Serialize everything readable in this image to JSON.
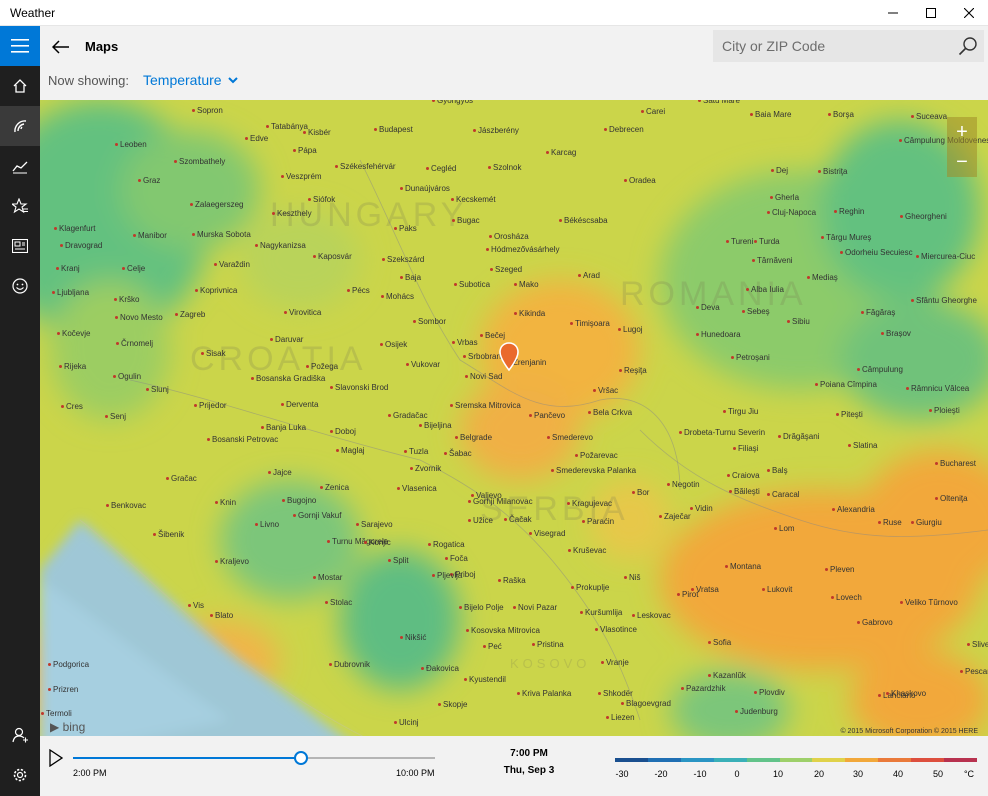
{
  "window": {
    "title": "Weather"
  },
  "header": {
    "page_title": "Maps",
    "now_showing_label": "Now showing:",
    "now_showing_value": "Temperature",
    "search_placeholder": "City or ZIP Code"
  },
  "sidebar": {
    "items": [
      "home-icon",
      "maps-icon",
      "historical-weather-icon",
      "favorites-icon",
      "news-icon",
      "feedback-icon",
      "account-icon",
      "settings-icon"
    ],
    "active_index": 1,
    "accent": "#0078d7"
  },
  "map": {
    "country_labels": [
      "HUNGARY",
      "ROMANIA",
      "CROATIA",
      "SERBIA",
      "KOSOVO"
    ],
    "cities": [
      {
        "name": "Gyongyos"
      },
      {
        "name": "Satu Mare"
      },
      {
        "name": "Sopron"
      },
      {
        "name": "Tatabánya"
      },
      {
        "name": "Budapest"
      },
      {
        "name": "Jászberény"
      },
      {
        "name": "Debrecen"
      },
      {
        "name": "Carei"
      },
      {
        "name": "Baia Mare"
      },
      {
        "name": "Borşa"
      },
      {
        "name": "Suceava"
      },
      {
        "name": "Kisbér"
      },
      {
        "name": "Edve"
      },
      {
        "name": "Leoben"
      },
      {
        "name": "Pápa"
      },
      {
        "name": "Szombathely"
      },
      {
        "name": "Székesfehérvár"
      },
      {
        "name": "Cegléd"
      },
      {
        "name": "Szolnok"
      },
      {
        "name": "Karcag"
      },
      {
        "name": "Câmpulung Moldovenesc"
      },
      {
        "name": "Graz"
      },
      {
        "name": "Veszprém"
      },
      {
        "name": "Dunaújváros"
      },
      {
        "name": "Kecskemét"
      },
      {
        "name": "Oradea"
      },
      {
        "name": "Dej"
      },
      {
        "name": "Bistriţa"
      },
      {
        "name": "Siófok"
      },
      {
        "name": "Gherla"
      },
      {
        "name": "Zalaegerszeg"
      },
      {
        "name": "Keszthely"
      },
      {
        "name": "Bugac"
      },
      {
        "name": "Békéscsaba"
      },
      {
        "name": "Cluj-Napoca"
      },
      {
        "name": "Reghin"
      },
      {
        "name": "Gheorgheni"
      },
      {
        "name": "Klagenfurt"
      },
      {
        "name": "Paks"
      },
      {
        "name": "Orosháza"
      },
      {
        "name": "Turda"
      },
      {
        "name": "Manibor"
      },
      {
        "name": "Murska Sobota"
      },
      {
        "name": "Hódmezővásárhely"
      },
      {
        "name": "Tureni"
      },
      {
        "name": "Târgu Mureş"
      },
      {
        "name": "Dravograd"
      },
      {
        "name": "Nagykanizsa"
      },
      {
        "name": "Kaposvár"
      },
      {
        "name": "Szekszárd"
      },
      {
        "name": "Odorheiu Secuiesc"
      },
      {
        "name": "Miercurea-Ciuc"
      },
      {
        "name": "Varaždin"
      },
      {
        "name": "Szeged"
      },
      {
        "name": "Târnăveni"
      },
      {
        "name": "Kranj"
      },
      {
        "name": "Celje"
      },
      {
        "name": "Koprivnica"
      },
      {
        "name": "Pécs"
      },
      {
        "name": "Baja"
      },
      {
        "name": "Subotica"
      },
      {
        "name": "Arad"
      },
      {
        "name": "Mediaş"
      },
      {
        "name": "Ljubljana"
      },
      {
        "name": "Mohács"
      },
      {
        "name": "Mako"
      },
      {
        "name": "Alba Iulia"
      },
      {
        "name": "Sfântu Gheorghe"
      },
      {
        "name": "Krško"
      },
      {
        "name": "Virovitica"
      },
      {
        "name": "Kikinda"
      },
      {
        "name": "Timişoara"
      },
      {
        "name": "Deva"
      },
      {
        "name": "Sebeş"
      },
      {
        "name": "Făgăraş"
      },
      {
        "name": "Kočevje"
      },
      {
        "name": "Novo Mesto"
      },
      {
        "name": "Zagreb"
      },
      {
        "name": "Sombor"
      },
      {
        "name": "Lugoj"
      },
      {
        "name": "Sibiu"
      },
      {
        "name": "Brașov"
      },
      {
        "name": "Bečej"
      },
      {
        "name": "Daruvar"
      },
      {
        "name": "Hunedoara"
      },
      {
        "name": "Črnomelj"
      },
      {
        "name": "Osijek"
      },
      {
        "name": "Vrbas"
      },
      {
        "name": "Srbobran"
      },
      {
        "name": "Zrenjanin"
      },
      {
        "name": "Sisak"
      },
      {
        "name": "Petroşani"
      },
      {
        "name": "Rijeka"
      },
      {
        "name": "Vukovar"
      },
      {
        "name": "Novi Sad"
      },
      {
        "name": "Reşiţa"
      },
      {
        "name": "Câmpulung"
      },
      {
        "name": "Ogulin"
      },
      {
        "name": "Bosanska Gradiška"
      },
      {
        "name": "Požega"
      },
      {
        "name": "Slavonski Brod"
      },
      {
        "name": "Vršac"
      },
      {
        "name": "Râmnicu Vâlcea"
      },
      {
        "name": "Poiana Cîmpina"
      },
      {
        "name": "Slunj"
      },
      {
        "name": "Prijedor"
      },
      {
        "name": "Derventa"
      },
      {
        "name": "Sremska Mitrovica"
      },
      {
        "name": "Bela Crkva"
      },
      {
        "name": "Cres"
      },
      {
        "name": "Gradačac"
      },
      {
        "name": "Pančevo"
      },
      {
        "name": "Tirgu Jiu"
      },
      {
        "name": "Piteşti"
      },
      {
        "name": "Ploieşti"
      },
      {
        "name": "Senj"
      },
      {
        "name": "Banja Luka"
      },
      {
        "name": "Doboj"
      },
      {
        "name": "Bijeljina"
      },
      {
        "name": "Belgrade"
      },
      {
        "name": "Smederevo"
      },
      {
        "name": "Drobeta-Turnu Severin"
      },
      {
        "name": "Drăgăşani"
      },
      {
        "name": "Bosanski Petrovac"
      },
      {
        "name": "Maglaj"
      },
      {
        "name": "Tuzla"
      },
      {
        "name": "Šabac"
      },
      {
        "name": "Požarevac"
      },
      {
        "name": "Filiaşi"
      },
      {
        "name": "Slatina"
      },
      {
        "name": "Bucharest"
      },
      {
        "name": "Jajce"
      },
      {
        "name": "Zvornik"
      },
      {
        "name": "Smederevska Palanka"
      },
      {
        "name": "Craiova"
      },
      {
        "name": "Balş"
      },
      {
        "name": "Gračac"
      },
      {
        "name": "Zenica"
      },
      {
        "name": "Vlasenica"
      },
      {
        "name": "Valjevo"
      },
      {
        "name": "Negotin"
      },
      {
        "name": "Băileşti"
      },
      {
        "name": "Caracal"
      },
      {
        "name": "Olteniţa"
      },
      {
        "name": "Benkovac"
      },
      {
        "name": "Knin"
      },
      {
        "name": "Bugojno"
      },
      {
        "name": "Gornji Milanovac"
      },
      {
        "name": "Kragujevac"
      },
      {
        "name": "Bor"
      },
      {
        "name": "Vidin"
      },
      {
        "name": "Alexandria"
      },
      {
        "name": "Gornji Vakuf"
      },
      {
        "name": "Užice"
      },
      {
        "name": "Čačak"
      },
      {
        "name": "Paraćin"
      },
      {
        "name": "Zaječar"
      },
      {
        "name": "Ruse"
      },
      {
        "name": "Giurgiu"
      },
      {
        "name": "Šibenik"
      },
      {
        "name": "Livno"
      },
      {
        "name": "Sarajevo"
      },
      {
        "name": "Lom"
      },
      {
        "name": "Turnu Măgurele"
      },
      {
        "name": "Konjic"
      },
      {
        "name": "Rogatica"
      },
      {
        "name": "Visegrad"
      },
      {
        "name": "Kraljevo"
      },
      {
        "name": "Split"
      },
      {
        "name": "Foča"
      },
      {
        "name": "Priboj"
      },
      {
        "name": "Kruševac"
      },
      {
        "name": "Montana"
      },
      {
        "name": "Pleven"
      },
      {
        "name": "Mostar"
      },
      {
        "name": "Pljevlja"
      },
      {
        "name": "Raška"
      },
      {
        "name": "Niš"
      },
      {
        "name": "Vratsa"
      },
      {
        "name": "Lukovit"
      },
      {
        "name": "Prokuplje"
      },
      {
        "name": "Vis"
      },
      {
        "name": "Stolac"
      },
      {
        "name": "Bijelo Polje"
      },
      {
        "name": "Novi Pazar"
      },
      {
        "name": "Kuršumlija"
      },
      {
        "name": "Pirot"
      },
      {
        "name": "Lovech"
      },
      {
        "name": "Veliko Tŭrnovo"
      },
      {
        "name": "Blato"
      },
      {
        "name": "Leskovac"
      },
      {
        "name": "Kosovska Mitrovica"
      },
      {
        "name": "Vlasotince"
      },
      {
        "name": "Gabrovo"
      },
      {
        "name": "Nikšić"
      },
      {
        "name": "Pristina"
      },
      {
        "name": "Sofia"
      },
      {
        "name": "Sliven"
      },
      {
        "name": "Dubrovnik"
      },
      {
        "name": "Peć"
      },
      {
        "name": "Vranje"
      },
      {
        "name": "Kazanlŭk"
      },
      {
        "name": "Pescara"
      },
      {
        "name": "Podgorica"
      },
      {
        "name": "Đakovica"
      },
      {
        "name": "Kyustendil"
      },
      {
        "name": "Pazardzhik"
      },
      {
        "name": "Plovdiv"
      },
      {
        "name": "Lanciano"
      },
      {
        "name": "Prizren"
      },
      {
        "name": "Kriva Palanka"
      },
      {
        "name": "Shkodër"
      },
      {
        "name": "Skopje"
      },
      {
        "name": "Blagoevgrad"
      },
      {
        "name": "Khaskovo"
      },
      {
        "name": "Termoli"
      },
      {
        "name": "Ulcinj"
      },
      {
        "name": "Liezen"
      },
      {
        "name": "Judenburg"
      }
    ],
    "attribution_logo": "bing",
    "copyright": "© 2015 Microsoft Corporation    © 2015 HERE",
    "zoom_in": "+",
    "zoom_out": "−"
  },
  "timeline": {
    "start_label": "2:00 PM",
    "end_label": "10:00 PM",
    "current_time": "7:00 PM",
    "current_date": "Thu, Sep 3",
    "progress": 0.63
  },
  "legend": {
    "colors": [
      "#1a4f8f",
      "#1f6fb3",
      "#2a95c4",
      "#3ab0b8",
      "#62c38a",
      "#9ed06a",
      "#e0d24a",
      "#f2a83a",
      "#ea7a3a",
      "#dd4f3e",
      "#b8324f"
    ],
    "ticks": [
      "-30",
      "-20",
      "-10",
      "0",
      "10",
      "20",
      "30",
      "40",
      "50",
      "°C"
    ]
  }
}
